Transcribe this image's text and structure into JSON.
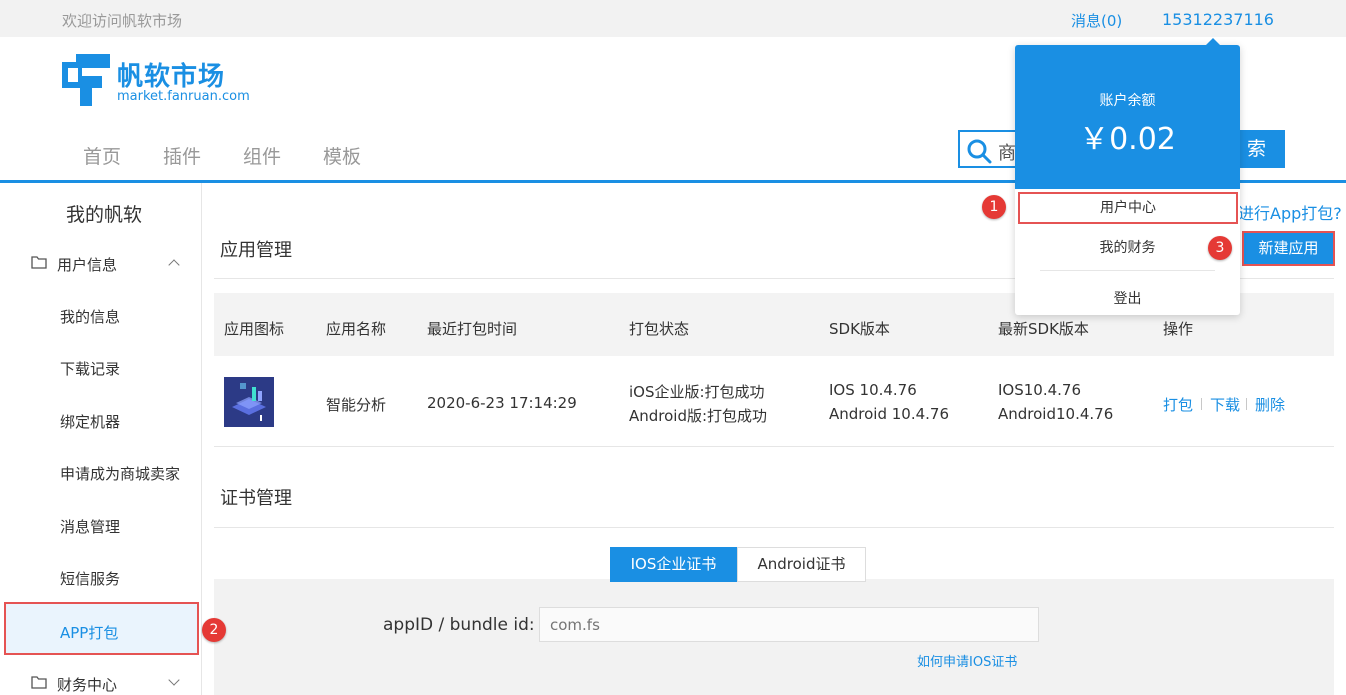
{
  "topbar": {
    "welcome": "欢迎访问帆软市场",
    "messages": "消息(0)",
    "phone": "15312237116"
  },
  "logo": {
    "cn": "帆软市场",
    "en": "market.fanruan.com"
  },
  "nav": {
    "items": [
      "首页",
      "插件",
      "组件",
      "模板"
    ]
  },
  "search": {
    "placeholder_visible": "商",
    "button_visible": "索"
  },
  "dropdown": {
    "balance_label": "账户余额",
    "balance": "￥0.02",
    "items": [
      "用户中心",
      "我的财务",
      "登出"
    ]
  },
  "sidebar": {
    "title": "我的帆软",
    "group_user": "用户信息",
    "items": [
      "我的信息",
      "下载记录",
      "绑定机器",
      "申请成为商城卖家",
      "消息管理",
      "短信服务"
    ],
    "active": "APP打包",
    "group_finance": "财务中心"
  },
  "main": {
    "app_section": "应用管理",
    "how_link": "进行App打包?",
    "new_app": "新建应用",
    "table": {
      "headers": [
        "应用图标",
        "应用名称",
        "最近打包时间",
        "打包状态",
        "SDK版本",
        "最新SDK版本",
        "操作"
      ],
      "row": {
        "name": "智能分析",
        "time": "2020-6-23 17:14:29",
        "status": [
          "iOS企业版:打包成功",
          "Android版:打包成功"
        ],
        "sdk": [
          "IOS 10.4.76",
          "Android 10.4.76"
        ],
        "latest_sdk": [
          "IOS10.4.76",
          "Android10.4.76"
        ],
        "ops": [
          "打包",
          "下载",
          "删除"
        ]
      }
    },
    "cert_section": "证书管理",
    "cert_tabs": [
      "IOS企业证书",
      "Android证书"
    ],
    "form": {
      "appid_label": "appID / bundle id:",
      "appid_value": "com.fs",
      "cert_link": "如何申请IOS证书"
    }
  },
  "badges": [
    "1",
    "2",
    "3"
  ],
  "colors": {
    "accent": "#1a8fe3",
    "highlight": "#e55353",
    "badge": "#e53935"
  }
}
